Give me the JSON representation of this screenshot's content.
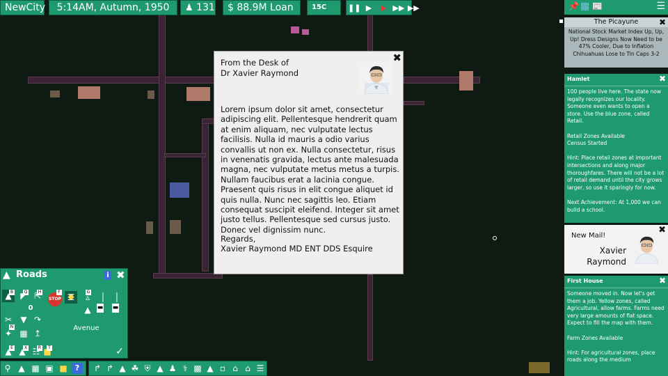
{
  "topbar": {
    "city_name": "NewCity",
    "datetime": "5:14AM,  Autumn,  1950",
    "population": "131",
    "money": "$ 88.9M Loan",
    "temperature": "15C",
    "speed_controls": [
      "pause",
      "play",
      "fast",
      "faster"
    ]
  },
  "letter": {
    "from_line1": "From the Desk of",
    "from_line2": "Dr Xavier Raymond",
    "body": "Lorem ipsum dolor sit amet, consectetur adipiscing elit. Pellentesque hendrerit quam at enim aliquam, nec vulputate lectus facilisis. Nulla id mauris a odio varius convallis ut non ex. Nulla consectetur, risus in venenatis gravida, lectus ante malesuada magna, nec vulputate metus metus a turpis. Nullam faucibus erat a lacinia congue. Praesent quis risus in elit congue aliquet id quis nulla. Nunc nec sagittis leo. Etiam consequat suscipit eleifend. Integer sit amet justo tellus. Pellentesque sed cursus justo. Donec vel dignissim nunc.",
    "regards": "Regards,",
    "signature": "Xavier Raymond MD ENT DDS Esquire"
  },
  "newspaper": {
    "title": "The Picayune",
    "headlines": "National Stock Market Index Up, Up, Up! Dress Designs Now Need to be 47% Cooler, Due to Inflation Chihuahuas Lose to Tin Caps 3-2"
  },
  "hamlet": {
    "title": "Hamlet",
    "p1": "100 people live here. The state now legally recognizes our locality. Someone even wants to open a store. Use the blue zone, called Retail.",
    "p2a": "Retail Zones Available",
    "p2b": "Census Started",
    "p3": "Hint: Place retail zones at important intersections and along major thoroughfares. There will not be a lot of retail demand until the city grows larger, so use it sparingly for now.",
    "p4": "Next Achievement: At 1,000 we can build a school."
  },
  "mail": {
    "title": "New Mail!",
    "first_name": "Xavier",
    "last_name": "Raymond"
  },
  "first_house": {
    "title": "First House",
    "p1": "Someone moved in. Now let's get them a job. Yellow zones, called Agricultural, allow farms. Farms need very large amounts of flat space. Expect to fill the map with them.",
    "p2": "Farm Zones Available",
    "p3": "Hint: For agricultural zones, place roads along the medium"
  },
  "roads_panel": {
    "title": "Roads",
    "info_label": "i",
    "lanes_value": "0",
    "selected_road": "Avenue",
    "confirm": "✓"
  },
  "colors": {
    "panel_green": "#1e9a6e",
    "map_dark": "#0e1a12",
    "road": "#3a2433"
  }
}
